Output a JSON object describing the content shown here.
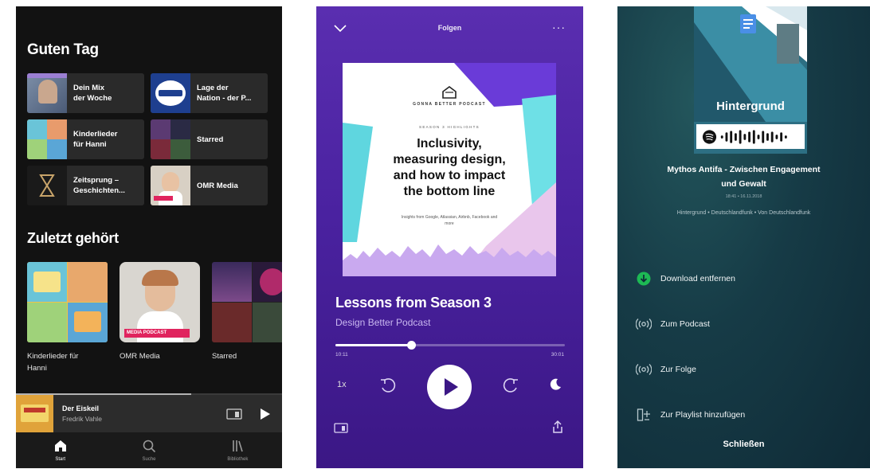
{
  "home": {
    "greeting": "Guten Tag",
    "quick_items": [
      {
        "label": "Dein Mix\nder Woche"
      },
      {
        "label": "Lage der\nNation - der P..."
      },
      {
        "label": "Kinderlieder\nfür Hanni"
      },
      {
        "label": "Starred"
      },
      {
        "label": "Zeitsprung –\nGeschichten..."
      },
      {
        "label": "OMR Media"
      }
    ],
    "recent_title": "Zuletzt gehört",
    "recent_items": [
      {
        "label": "Kinderlieder für\nHanni"
      },
      {
        "label": "OMR Media",
        "badge": "MEDIA PODCAST"
      },
      {
        "label": "Starred"
      }
    ],
    "mini_player": {
      "title": "Der Eiskeil",
      "artist": "Fredrik Vahle",
      "progress": 0.66
    },
    "tabs": [
      {
        "label": "Start",
        "active": true
      },
      {
        "label": "Suche",
        "active": false
      },
      {
        "label": "Bibliothek",
        "active": false
      }
    ]
  },
  "now_playing": {
    "context": "Folgen",
    "more": "···",
    "cover": {
      "brand": "GONNA BETTER PODCAST",
      "kicker": "SEASON 3 HIGHLIGHTS",
      "headline": "Inclusivity,\nmeasuring design,\nand how to impact\nthe bottom line",
      "guests": "Insights from Google, Atlassian, Airbnb, Facebook and more"
    },
    "title": "Lessons from Season 3",
    "show": "Design Better Podcast",
    "elapsed": "10:11",
    "total": "30:01",
    "progress": 0.33,
    "speed": "1x"
  },
  "context_menu": {
    "art_title": "Hintergrund",
    "episode_title": "Mythos Antifa - Zwischen Engagement\nund Gewalt",
    "date": "18:41 • 16.11.2018",
    "show_line": "Hintergrund • Deutschlandfunk • Von Deutschlandfunk",
    "items": [
      {
        "label": "Download entfernen",
        "icon": "download-check-icon"
      },
      {
        "label": "Zum Podcast",
        "icon": "podcast-icon"
      },
      {
        "label": "Zur Folge",
        "icon": "episode-icon"
      },
      {
        "label": "Zur Playlist hinzufügen",
        "icon": "add-to-playlist-icon"
      }
    ],
    "close": "Schließen"
  },
  "colors": {
    "spotify_green": "#1db954",
    "np_purple": "#4a22a0",
    "ctx_teal": "#163b46",
    "home_bg": "#121212"
  }
}
